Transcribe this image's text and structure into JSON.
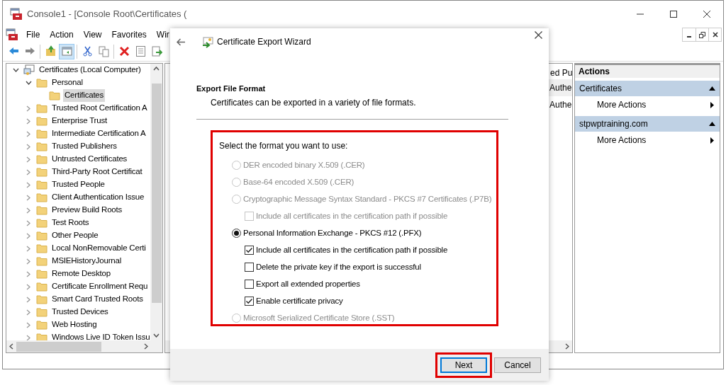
{
  "window": {
    "title": "Console1 - [Console Root\\Certificates ("
  },
  "menu": [
    "File",
    "Action",
    "View",
    "Favorites",
    "Wir"
  ],
  "toolbar_buttons": [
    {
      "pressed": false
    },
    {
      "pressed": false
    },
    {
      "pressed": false
    },
    {
      "pressed": true
    },
    {
      "pressed": false
    },
    {
      "pressed": false
    },
    {
      "pressed": false
    },
    {
      "pressed": false
    },
    {
      "pressed": false
    }
  ],
  "tree": [
    {
      "label": "Certificates (Local Computer)",
      "expanded": true,
      "selected": false,
      "kind": "root",
      "children": [
        {
          "label": "Personal",
          "expanded": true,
          "selected": false,
          "children": [
            {
              "label": "Certificates",
              "selected": true
            }
          ]
        },
        {
          "label": "Trusted Root Certification A",
          "expanded": false,
          "selected": false
        },
        {
          "label": "Enterprise Trust",
          "expanded": false,
          "selected": false
        },
        {
          "label": "Intermediate Certification A",
          "expanded": false,
          "selected": false
        },
        {
          "label": "Trusted Publishers",
          "expanded": false,
          "selected": false
        },
        {
          "label": "Untrusted Certificates",
          "expanded": false,
          "selected": false
        },
        {
          "label": "Third-Party Root Certificat",
          "expanded": false,
          "selected": false
        },
        {
          "label": "Trusted People",
          "expanded": false,
          "selected": false
        },
        {
          "label": "Client Authentication Issue",
          "expanded": false,
          "selected": false
        },
        {
          "label": "Preview Build Roots",
          "expanded": false,
          "selected": false
        },
        {
          "label": "Test Roots",
          "expanded": false,
          "selected": false
        },
        {
          "label": "Other People",
          "expanded": false,
          "selected": false
        },
        {
          "label": "Local NonRemovable Certi",
          "expanded": false,
          "selected": false
        },
        {
          "label": "MSIEHistoryJournal",
          "expanded": false,
          "selected": false
        },
        {
          "label": "Remote Desktop",
          "expanded": false,
          "selected": false
        },
        {
          "label": "Certificate Enrollment Requ",
          "expanded": false,
          "selected": false
        },
        {
          "label": "Smart Card Trusted Roots",
          "expanded": false,
          "selected": false
        },
        {
          "label": "Trusted Devices",
          "expanded": false,
          "selected": false
        },
        {
          "label": "Web Hosting",
          "expanded": false,
          "selected": false
        },
        {
          "label": "Windows Live ID Token Issu",
          "expanded": false,
          "selected": false
        }
      ]
    }
  ],
  "list": {
    "column_header": "ed Pu",
    "rows": [
      "Authe",
      "Authe"
    ]
  },
  "actions": {
    "title": "Actions",
    "sections": [
      {
        "title": "Certificates",
        "expanded": true,
        "items": [
          "More Actions"
        ]
      },
      {
        "title": "stpwptraining.com",
        "expanded": true,
        "items": [
          "More Actions"
        ]
      }
    ]
  },
  "dialog": {
    "title": "Certificate Export Wizard",
    "heading": "Export File Format",
    "subheading": "Certificates can be exported in a variety of file formats.",
    "prompt": "Select the format you want to use:",
    "options": [
      {
        "kind": "radio",
        "label": "DER encoded binary X.509 (.CER)",
        "selected": false,
        "disabled": true
      },
      {
        "kind": "radio",
        "label": "Base-64 encoded X.509 (.CER)",
        "selected": false,
        "disabled": true
      },
      {
        "kind": "radio",
        "label": "Cryptographic Message Syntax Standard - PKCS #7 Certificates (.P7B)",
        "selected": false,
        "disabled": true,
        "children": [
          {
            "kind": "checkbox",
            "label": "Include all certificates in the certification path if possible",
            "checked": false,
            "disabled": true
          }
        ]
      },
      {
        "kind": "radio",
        "label": "Personal Information Exchange - PKCS #12 (.PFX)",
        "selected": true,
        "disabled": false,
        "children": [
          {
            "kind": "checkbox",
            "label": "Include all certificates in the certification path if possible",
            "checked": true,
            "disabled": false
          },
          {
            "kind": "checkbox",
            "label": "Delete the private key if the export is successful",
            "checked": false,
            "disabled": false
          },
          {
            "kind": "checkbox",
            "label": "Export all extended properties",
            "checked": false,
            "disabled": false
          },
          {
            "kind": "checkbox",
            "label": "Enable certificate privacy",
            "checked": true,
            "disabled": false
          }
        ]
      },
      {
        "kind": "radio",
        "label": "Microsoft Serialized Certificate Store (.SST)",
        "selected": false,
        "disabled": true
      }
    ],
    "buttons": [
      {
        "label": "Next",
        "default": true
      },
      {
        "label": "Cancel",
        "default": false
      }
    ]
  }
}
